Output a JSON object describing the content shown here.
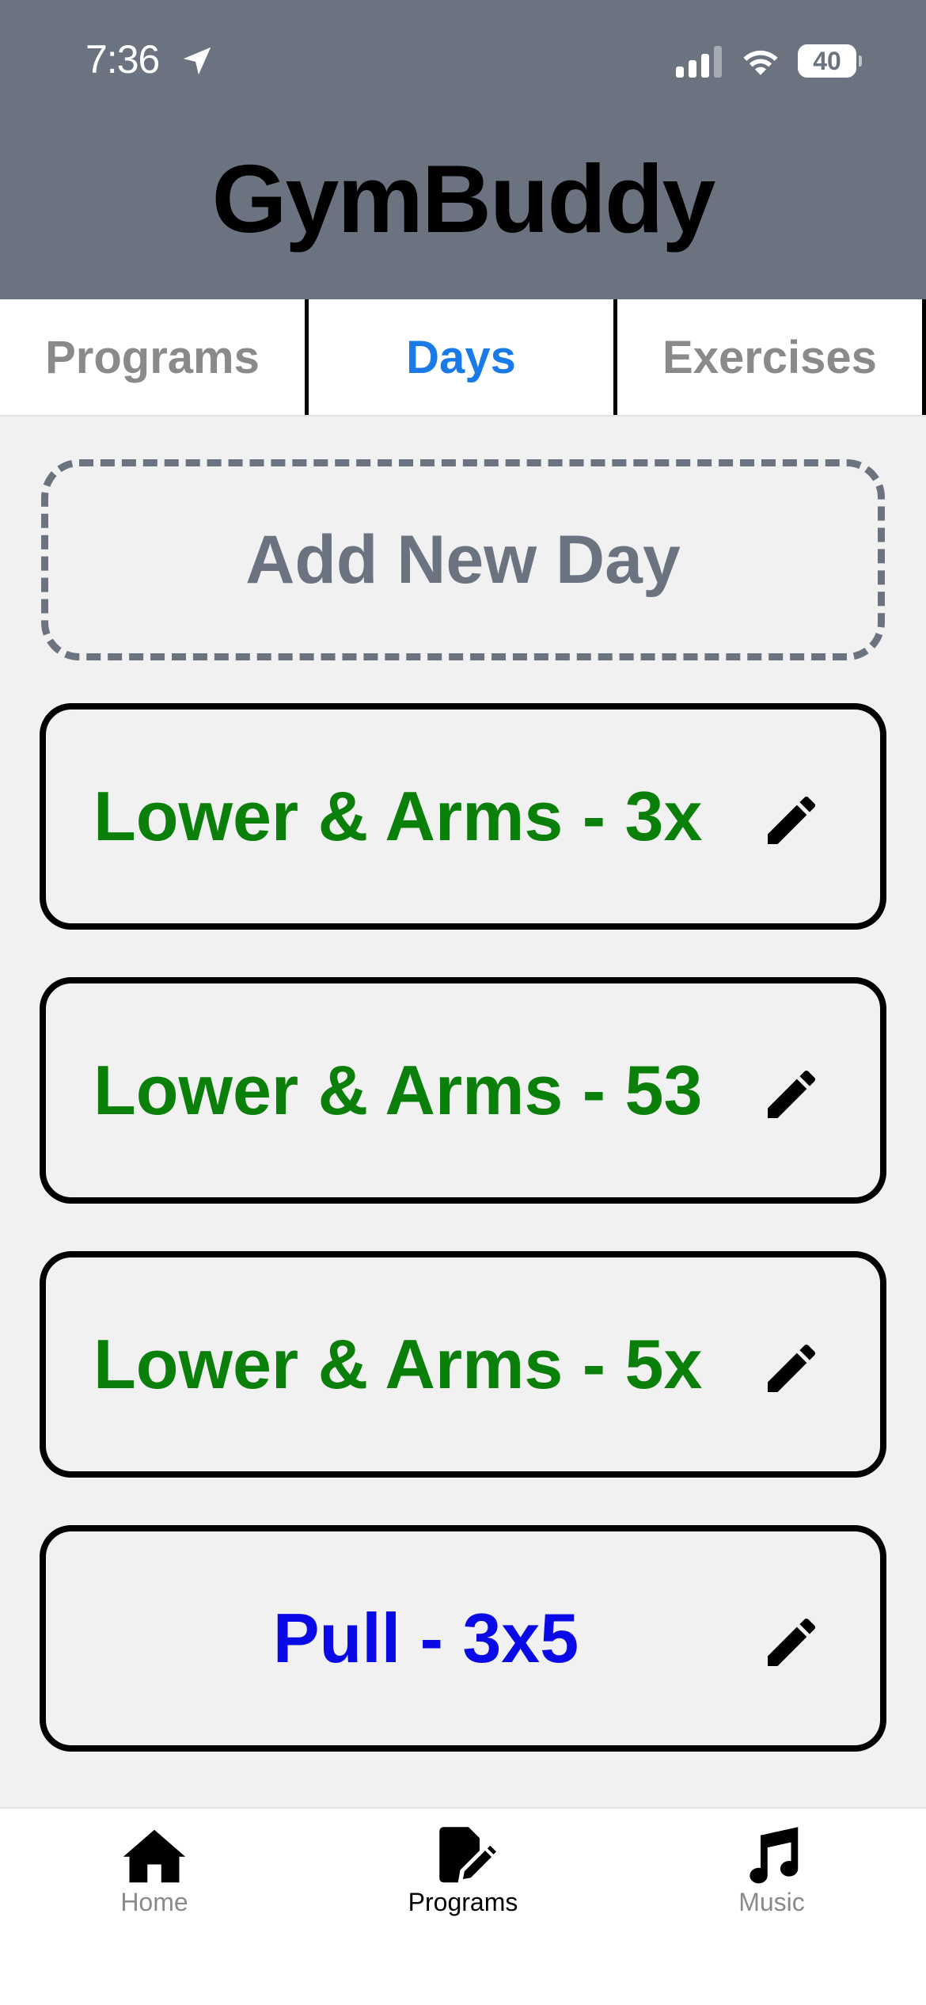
{
  "status_bar": {
    "time": "7:36",
    "battery": "40",
    "battery_level": 0.4
  },
  "app": {
    "title": "GymBuddy"
  },
  "tabs": [
    {
      "label": "Programs",
      "active": false
    },
    {
      "label": "Days",
      "active": true
    },
    {
      "label": "Exercises",
      "active": false
    }
  ],
  "add_day": {
    "label": "Add New Day"
  },
  "days": [
    {
      "name": "Lower & Arms - 3x",
      "color": "#0a7f0a"
    },
    {
      "name": "Lower & Arms - 53",
      "color": "#0a7f0a"
    },
    {
      "name": "Lower & Arms - 5x",
      "color": "#0a7f0a"
    },
    {
      "name": "Pull - 3x5",
      "color": "#0a0ae6"
    }
  ],
  "colors": {
    "header_bg": "#6b7280",
    "active_tab": "#1a7be8",
    "page_bg": "#f1f1f1"
  },
  "bottom_nav": [
    {
      "label": "Home",
      "icon": "home-icon",
      "active": false
    },
    {
      "label": "Programs",
      "icon": "edit-document-icon",
      "active": true
    },
    {
      "label": "Music",
      "icon": "music-note-icon",
      "active": false
    }
  ]
}
